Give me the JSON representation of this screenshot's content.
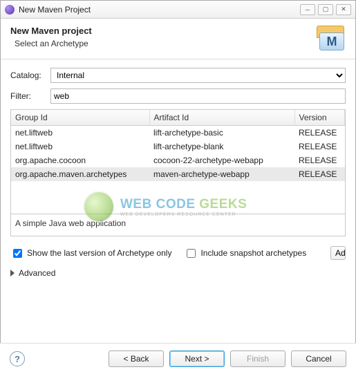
{
  "window": {
    "title": "New Maven Project"
  },
  "header": {
    "title": "New Maven project",
    "subtitle": "Select an Archetype"
  },
  "form": {
    "catalog_label": "Catalog:",
    "catalog_value": "Internal",
    "filter_label": "Filter:",
    "filter_value": "web"
  },
  "table": {
    "columns": {
      "group": "Group Id",
      "artifact": "Artifact Id",
      "version": "Version"
    },
    "rows": [
      {
        "group": "net.liftweb",
        "artifact": "lift-archetype-basic",
        "version": "RELEASE",
        "selected": false
      },
      {
        "group": "net.liftweb",
        "artifact": "lift-archetype-blank",
        "version": "RELEASE",
        "selected": false
      },
      {
        "group": "org.apache.cocoon",
        "artifact": "cocoon-22-archetype-webapp",
        "version": "RELEASE",
        "selected": false
      },
      {
        "group": "org.apache.maven.archetypes",
        "artifact": "maven-archetype-webapp",
        "version": "RELEASE",
        "selected": true
      }
    ],
    "description": "A simple Java web application"
  },
  "options": {
    "show_last_label": "Show the last version of Archetype only",
    "show_last_checked": true,
    "include_snapshot_label": "Include snapshot archetypes",
    "include_snapshot_checked": false,
    "add_button": "Ad"
  },
  "advanced_label": "Advanced",
  "buttons": {
    "back": "< Back",
    "next": "Next >",
    "finish": "Finish",
    "cancel": "Cancel"
  },
  "watermark": {
    "line1_a": "WEB CODE ",
    "line1_b": "GEEKS",
    "line2": "WEB DEVELOPERS RESOURCE CENTER"
  }
}
